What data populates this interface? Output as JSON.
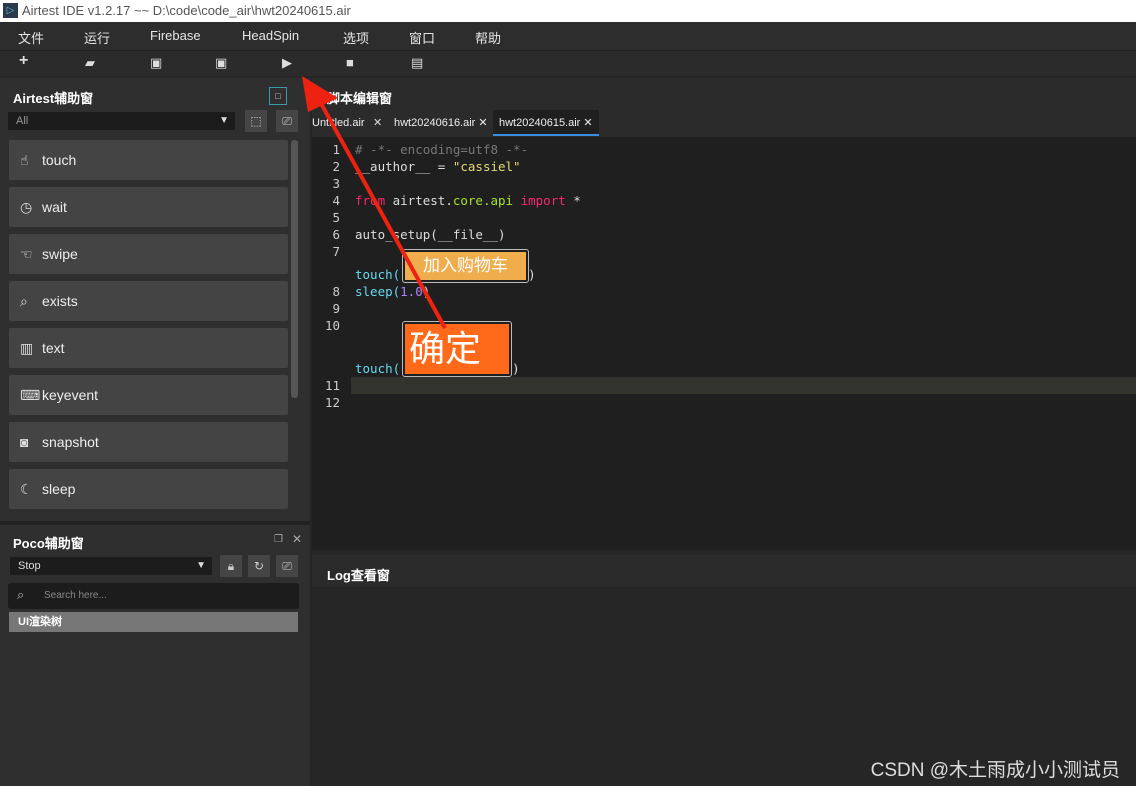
{
  "window": {
    "title": "Airtest IDE v1.2.17 ~~ D:\\code\\code_air\\hwt20240615.air"
  },
  "menu": [
    "文件",
    "运行",
    "Firebase",
    "HeadSpin",
    "选项",
    "窗口",
    "帮助"
  ],
  "toolbar": {
    "icons": [
      "new-icon",
      "open-folder-icon",
      "save-icon",
      "save-as-icon",
      "run-icon",
      "stop-icon",
      "log-icon"
    ]
  },
  "airtest_panel": {
    "title": "Airtest辅助窗",
    "filter": "All",
    "items": [
      {
        "label": "touch",
        "icon": "hand-tap-icon"
      },
      {
        "label": "wait",
        "icon": "clock-icon"
      },
      {
        "label": "swipe",
        "icon": "hand-swipe-icon"
      },
      {
        "label": "exists",
        "icon": "check-search-icon"
      },
      {
        "label": "text",
        "icon": "text-box-icon"
      },
      {
        "label": "keyevent",
        "icon": "keyboard-icon"
      },
      {
        "label": "snapshot",
        "icon": "camera-icon"
      },
      {
        "label": "sleep",
        "icon": "moon-icon"
      }
    ]
  },
  "poco_panel": {
    "title": "Poco辅助窗",
    "mode": "Stop",
    "search_placeholder": "Search here...",
    "tree_root": "UI渲染树"
  },
  "editor": {
    "title": "脚本编辑窗",
    "tabs": [
      {
        "label": "Untitled.air"
      },
      {
        "label": "hwt20240616.air"
      },
      {
        "label": "hwt20240615.air",
        "active": true
      }
    ],
    "lines": {
      "l1": "# -*- encoding=utf8 -*-",
      "l2a": "__author__ = ",
      "l2b": "\"cassiel\"",
      "l4a": "from",
      "l4b": " airtest.",
      "l4c": "core.api",
      "l4d": " import",
      "l4e": " *",
      "l6": "auto_setup(__file__)",
      "touch": "touch(",
      "close": ")",
      "sleep": "sleep(",
      "num": "1.0"
    },
    "images": [
      "加入购物车",
      "确定"
    ]
  },
  "log": {
    "title": "Log查看窗"
  },
  "watermark": "CSDN @木土雨成小小测试员",
  "colors": {
    "accent": "#3b8de0",
    "arrow": "#ee2211",
    "btn1": "#f0ad4e",
    "btn2": "#ff6a1a"
  }
}
